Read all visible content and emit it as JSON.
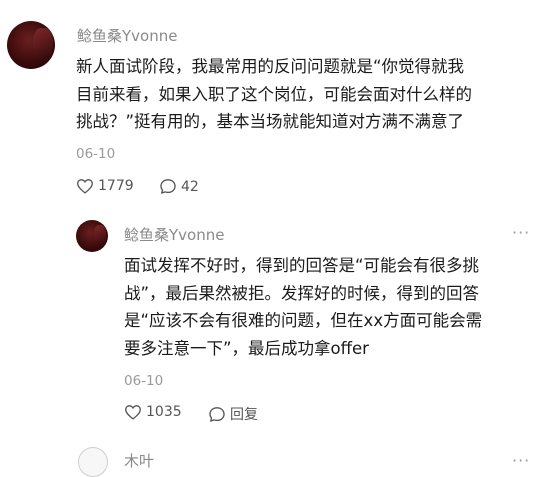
{
  "comments": [
    {
      "username": "鲶鱼桑Yvonne",
      "lines": [
        "新人面试阶段，我最常用的反问问题就是“你觉得就我",
        "目前来看，如果入职了这个岗位，可能会面对什么样的",
        "挑战？”挺有用的，基本当场就能知道对方满不满意了"
      ],
      "date": "06-10",
      "likes": "1779",
      "replies": "42",
      "more": "···"
    },
    {
      "username": "鲶鱼桑Yvonne",
      "lines": [
        "面试发挥不好时，得到的回答是“可能会有很多挑",
        "战”，最后果然被拒。发挥好的时候，得到的回答",
        "是“应该不会有很难的问题，但在xx方面可能会需",
        "要多注意一下”，最后成功拿offer"
      ],
      "date": "06-10",
      "likes": "1035",
      "reply_label": "回复",
      "more": "···"
    },
    {
      "username": "木叶",
      "more": "···"
    }
  ],
  "icons": {
    "heart": "heart-icon",
    "comment": "comment-icon",
    "more": "more-icon"
  }
}
